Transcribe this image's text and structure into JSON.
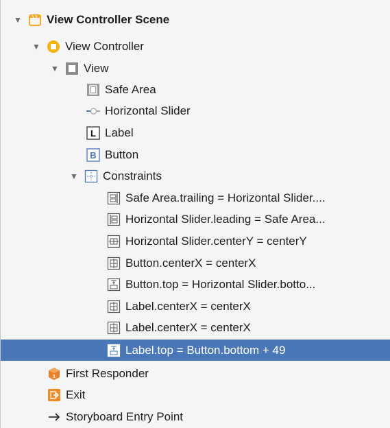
{
  "tree": {
    "scene": {
      "label": "View Controller Scene",
      "icon": "storyboard-scene-icon"
    },
    "view_controller": {
      "label": "View Controller",
      "icon": "view-controller-icon"
    },
    "view": {
      "label": "View",
      "icon": "view-icon"
    },
    "safe_area": {
      "label": "Safe Area",
      "icon": "safe-area-icon"
    },
    "slider": {
      "label": "Horizontal Slider",
      "icon": "slider-icon"
    },
    "label_item": {
      "label": "Label",
      "icon": "label-icon"
    },
    "button_item": {
      "label": "Button",
      "icon": "button-icon"
    },
    "constraints": {
      "label": "Constraints",
      "icon": "constraints-icon"
    },
    "constraint_items": [
      {
        "label": "Safe Area.trailing = Horizontal Slider....",
        "icon": "trailing-constraint-icon"
      },
      {
        "label": "Horizontal Slider.leading = Safe Area...",
        "icon": "leading-constraint-icon"
      },
      {
        "label": "Horizontal Slider.centerY = centerY",
        "icon": "center-y-constraint-icon"
      },
      {
        "label": "Button.centerX = centerX",
        "icon": "center-x-constraint-icon"
      },
      {
        "label": "Button.top = Horizontal Slider.botto...",
        "icon": "vertical-spacing-constraint-icon"
      },
      {
        "label": "Label.centerX = centerX",
        "icon": "center-x-constraint-icon"
      },
      {
        "label": "Label.centerX = centerX",
        "icon": "center-x-constraint-icon"
      },
      {
        "label": "Label.top = Button.bottom + 49",
        "icon": "vertical-spacing-constraint-icon"
      }
    ],
    "first_responder": {
      "label": "First Responder",
      "icon": "first-responder-icon"
    },
    "exit": {
      "label": "Exit",
      "icon": "exit-icon"
    },
    "entry_point": {
      "label": "Storyboard Entry Point",
      "icon": "arrow-right-icon"
    }
  },
  "colors": {
    "selection": "#4a77b8",
    "scene_icon": "#f5a623",
    "view_controller_icon": "#f5b400",
    "constraint_icon": "#4a77b8"
  }
}
